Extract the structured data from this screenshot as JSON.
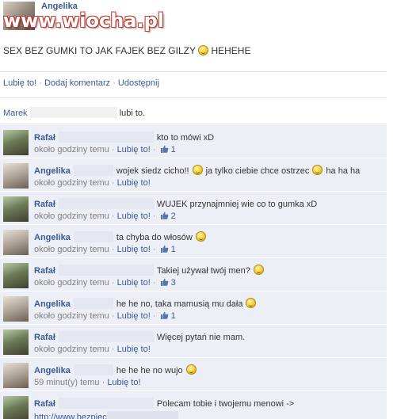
{
  "post": {
    "poster_name": "Angelika",
    "watermark": "www.wiocha.pl",
    "status_text": "SEX BEZ GUMKI TO JAK FAJEK BEZ GILZY",
    "status_suffix": "HEHEHE"
  },
  "actions": {
    "like": "Lubię to!",
    "sep1": " · ",
    "comment": "Dodaj komentarz",
    "sep2": " · ",
    "share": "Udostępnij"
  },
  "likes": {
    "name": "Marek",
    "suffix": "lubi to."
  },
  "comments": [
    {
      "author": "Rafał",
      "avatar": "rafal",
      "text": "kto to mówi xD",
      "emoji_after": false,
      "text2": "",
      "emoji2": false,
      "text3": "",
      "time": "około godziny temu",
      "like": "Lubię to!",
      "count": "1"
    },
    {
      "author": "Angelika",
      "avatar": "angelika",
      "text": "wojek siedz cicho!!",
      "emoji_after": true,
      "text2": "ja tylko ciebie chce ostrzec",
      "emoji2": true,
      "text3": "ha ha ha",
      "time": "około godziny temu",
      "like": "Lubię to!",
      "count": ""
    },
    {
      "author": "Rafał",
      "avatar": "rafal",
      "text": "WUJEK przynajmniej wie co to gumka xD",
      "emoji_after": false,
      "text2": "",
      "emoji2": false,
      "text3": "",
      "time": "około godziny temu",
      "like": "Lubię to!",
      "count": "2"
    },
    {
      "author": "Angelika",
      "avatar": "angelika",
      "text": "ta chyba do włosów",
      "emoji_after": true,
      "text2": "",
      "emoji2": false,
      "text3": "",
      "time": "około godziny temu",
      "like": "Lubię to!",
      "count": "1"
    },
    {
      "author": "Rafał",
      "avatar": "rafal",
      "text": "Takiej używał twój men?",
      "emoji_after": true,
      "text2": "",
      "emoji2": false,
      "text3": "",
      "time": "około godziny temu",
      "like": "Lubię to!",
      "count": "3"
    },
    {
      "author": "Angelika",
      "avatar": "angelika",
      "text": "he he no, taka mamusią mu dała",
      "emoji_after": true,
      "text2": "",
      "emoji2": false,
      "text3": "",
      "time": "około godziny temu",
      "like": "Lubię to!",
      "count": "1"
    },
    {
      "author": "Rafał",
      "avatar": "rafal",
      "text": "Więcej pytań nie mam.",
      "emoji_after": false,
      "text2": "",
      "emoji2": false,
      "text3": "",
      "time": "około godziny temu",
      "like": "Lubię to!",
      "count": ""
    },
    {
      "author": "Angelika",
      "avatar": "angelika",
      "text": "he he he no wujo",
      "emoji_after": true,
      "text2": "",
      "emoji2": false,
      "text3": "",
      "time": "59 minut(y) temu",
      "like": "Lubię to!",
      "count": ""
    },
    {
      "author": "Rafał",
      "avatar": "rafal",
      "text": "Polecam tobie i twojemu menowi ->",
      "emoji_after": false,
      "text2": "",
      "emoji2": false,
      "text3": "",
      "time": "http://www.bezpiec",
      "like": "",
      "count": ""
    }
  ],
  "colors": {
    "link": "#3b5998",
    "comment_bg": "#eceff5",
    "watermark_outline": "#c0392b"
  }
}
